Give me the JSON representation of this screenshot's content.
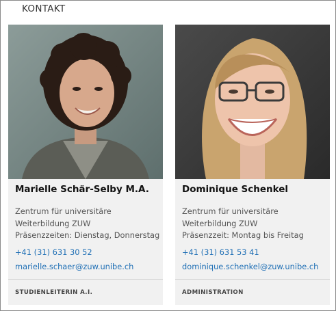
{
  "section": {
    "title": "KONTAKT"
  },
  "contacts": [
    {
      "name": "Marielle Schär-Selby M.A.",
      "org_lines": [
        "Zentrum für universitäre",
        "Weiterbildung ZUW",
        "Präsenzzeiten: Dienstag, Donnerstag"
      ],
      "phone": "+41 (31) 631 30 52",
      "email": "marielle.schaer@zuw.unibe.ch",
      "role": "STUDIENLEITERIN A.I."
    },
    {
      "name": "Dominique Schenkel",
      "org_lines": [
        "Zentrum für universitäre",
        "Weiterbildung ZUW",
        "Präsenzzeit: Montag bis Freitag"
      ],
      "phone": "+41 (31) 631 53 41",
      "email": "dominique.schenkel@zuw.unibe.ch",
      "role": "ADMINISTRATION"
    }
  ],
  "colors": {
    "link": "#1f6fb5",
    "card_bg": "#f1f1f1",
    "divider": "#cfcfcf"
  }
}
